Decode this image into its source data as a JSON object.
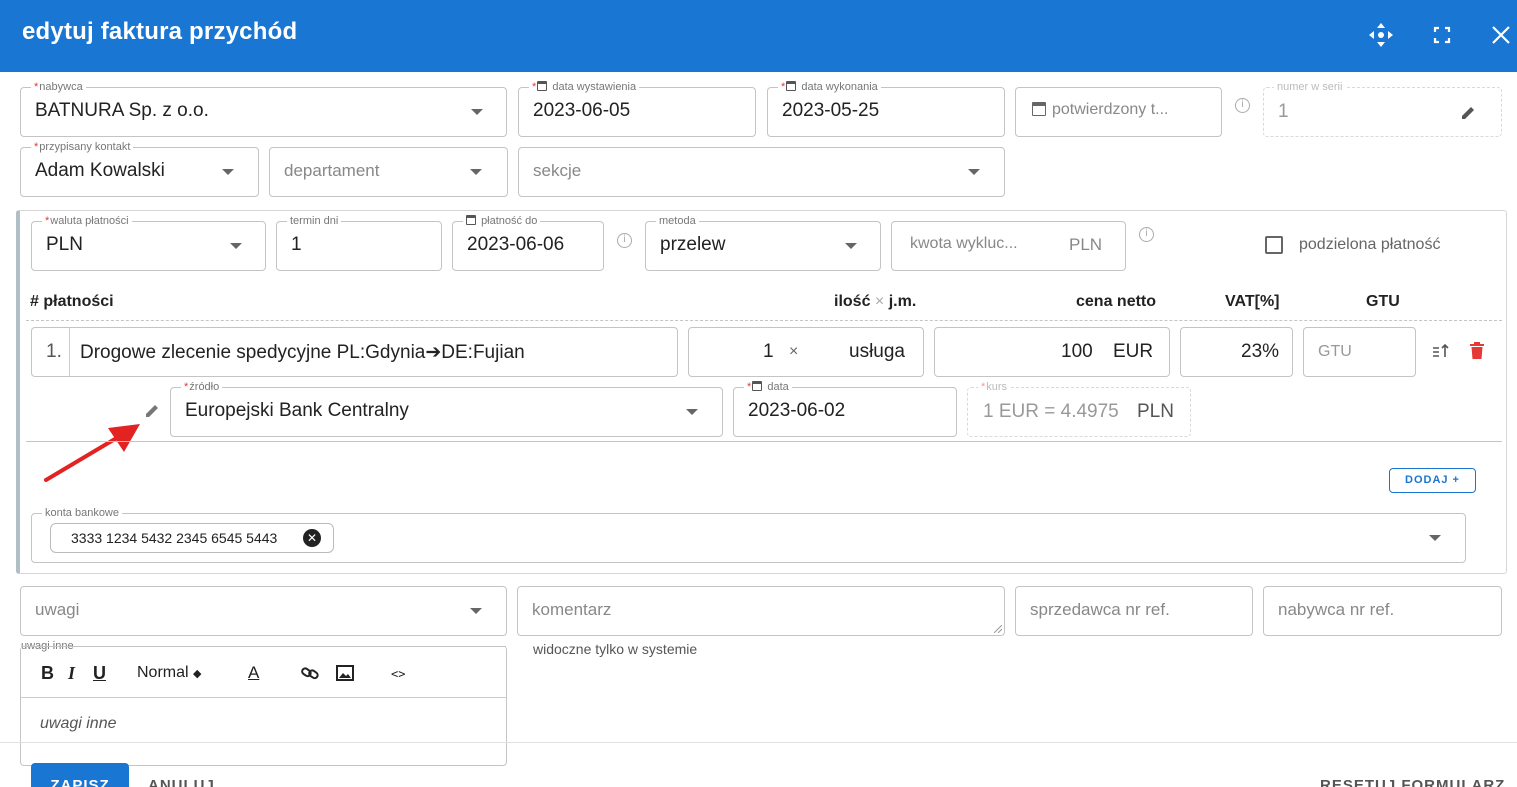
{
  "header": {
    "title": "edytuj  faktura przychód"
  },
  "row1": {
    "nabywca": {
      "label": "nabywca",
      "value": "BATNURA Sp. z o.o."
    },
    "data_wystawienia": {
      "label": "data wystawienia",
      "value": "2023-06-05"
    },
    "data_wykonania": {
      "label": "data wykonania",
      "value": "2023-05-25"
    },
    "potwierdzony": {
      "placeholder": "potwierdzony t..."
    },
    "numer": {
      "label": "numer w serii",
      "value": "1"
    }
  },
  "row2": {
    "kontakt": {
      "label": "przypisany kontakt",
      "value": "Adam Kowalski"
    },
    "departament": {
      "placeholder": "departament"
    },
    "sekcje": {
      "placeholder": "sekcje"
    }
  },
  "payment": {
    "waluta": {
      "label": "waluta płatności",
      "value": "PLN"
    },
    "termin": {
      "label": "termin dni",
      "value": "1"
    },
    "platnosc_do": {
      "label": "płatność do",
      "value": "2023-06-06"
    },
    "metoda": {
      "label": "metoda",
      "value": "przelew"
    },
    "kwota": {
      "placeholder": "kwota wykluc...",
      "currency": "PLN"
    },
    "podzielona": {
      "label": "podzielona płatność"
    }
  },
  "columns": {
    "platnosci": "# płatności",
    "ilosc": "ilość",
    "times": "×",
    "jm": "j.m.",
    "cena": "cena netto",
    "vat": "VAT[%]",
    "gtu": "GTU"
  },
  "item": {
    "number": "1.",
    "description": "Drogowe zlecenie spedycyjne PL:Gdynia➔DE:Fujian",
    "quantity": "1",
    "times": "×",
    "unit": "usługa",
    "price": "100",
    "currency": "EUR",
    "vat": "23%",
    "gtu_placeholder": "GTU"
  },
  "rate": {
    "zrodlo": {
      "label": "źródło",
      "value": "Europejski Bank Centralny"
    },
    "data": {
      "label": "data",
      "value": "2023-06-02"
    },
    "kurs": {
      "label": "kurs",
      "prefix": "1 EUR =",
      "value": "4.4975",
      "currency": "PLN"
    }
  },
  "dodaj_label": "DODAJ +",
  "konta": {
    "label": "konta bankowe",
    "chip": "3333 1234 5432 2345 6545 5443"
  },
  "row_bottom": {
    "uwagi": {
      "placeholder": "uwagi"
    },
    "komentarz": {
      "placeholder": "komentarz",
      "helper": "widoczne tylko w systemie"
    },
    "sprzedawca": {
      "placeholder": "sprzedawca nr ref."
    },
    "nabywca_ref": {
      "placeholder": "nabywca nr ref."
    }
  },
  "uwagi_inne": {
    "label": "uwagi inne",
    "placeholder": "uwagi inne",
    "toolbar": {
      "bold": "B",
      "italic": "I",
      "underline": "U",
      "format": "Normal",
      "color": "A",
      "code": "<>"
    }
  },
  "footer": {
    "zapisz": "ZAPISZ",
    "anuluj": "ANULUJ",
    "reset": "RESETUJ FORMULARZ"
  }
}
